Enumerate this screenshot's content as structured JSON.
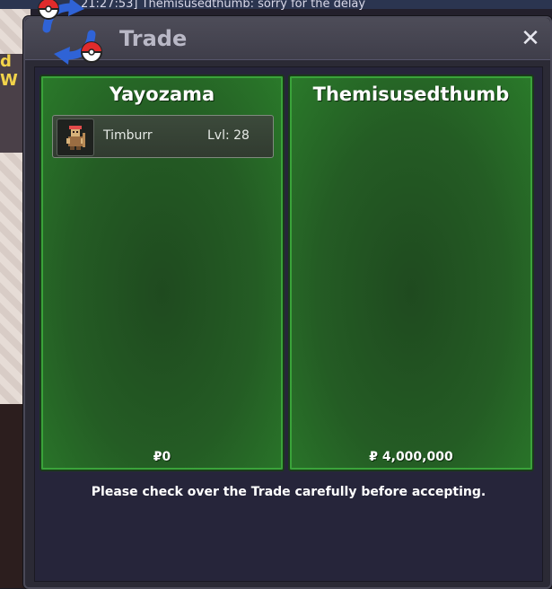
{
  "background": {
    "chat_line": "21:27:53] Themisusedthumb: sorry for the delay",
    "side_text": "d W"
  },
  "window": {
    "title": "Trade",
    "close_label": "✕"
  },
  "left_panel": {
    "player": "Yayozama",
    "items": [
      {
        "name": "Timburr",
        "level": "Lvl: 28",
        "icon": "timburr-sprite-icon"
      }
    ],
    "money": "₽0"
  },
  "right_panel": {
    "player": "Themisusedthumb",
    "items": [],
    "money": "₽ 4,000,000"
  },
  "notice": "Please check over the Trade carefully before accepting."
}
